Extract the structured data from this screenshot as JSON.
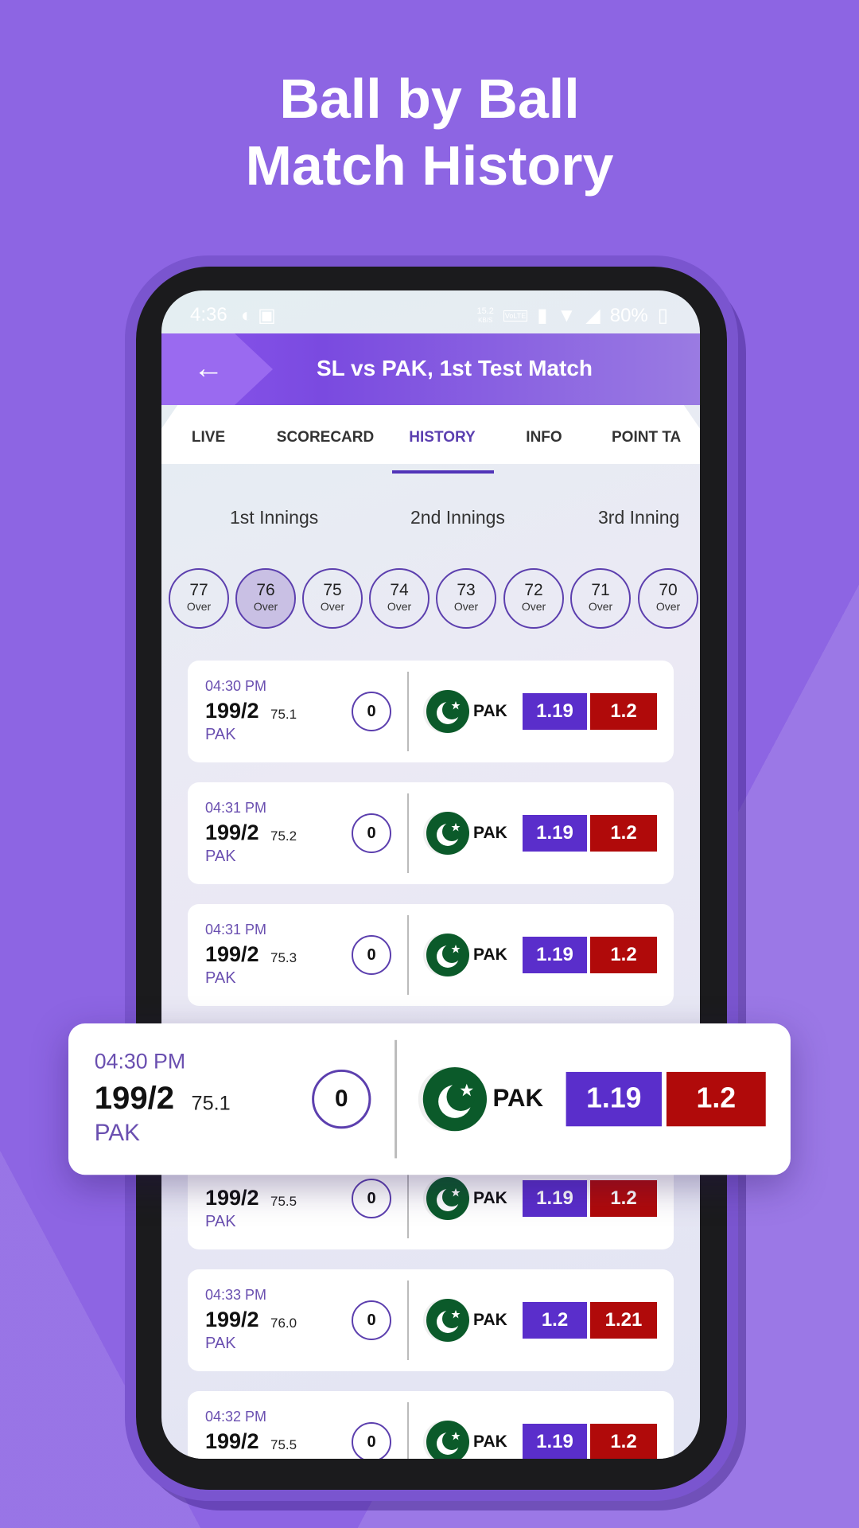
{
  "headline": {
    "line1": "Ball by Ball",
    "line2": "Match History"
  },
  "status_bar": {
    "time": "4:36",
    "speed": "15.2",
    "speed_unit": "KB/S",
    "network": "VoLTE",
    "battery": "80%"
  },
  "app_bar": {
    "title": "SL vs PAK, 1st Test Match",
    "back_icon": "arrow-left-icon"
  },
  "tabs": [
    {
      "label": "LIVE"
    },
    {
      "label": "SCORECARD"
    },
    {
      "label": "HISTORY",
      "active": true
    },
    {
      "label": "INFO"
    },
    {
      "label": "POINT TA"
    }
  ],
  "innings": [
    {
      "label": "1st Innings"
    },
    {
      "label": "2nd Innings"
    },
    {
      "label": "3rd Inning"
    }
  ],
  "overs": [
    {
      "n": "77",
      "l": "Over"
    },
    {
      "n": "76",
      "l": "Over",
      "selected": true
    },
    {
      "n": "75",
      "l": "Over"
    },
    {
      "n": "74",
      "l": "Over"
    },
    {
      "n": "73",
      "l": "Over"
    },
    {
      "n": "72",
      "l": "Over"
    },
    {
      "n": "71",
      "l": "Over"
    },
    {
      "n": "70",
      "l": "Over"
    }
  ],
  "rows": [
    {
      "time": "04:30 PM",
      "score": "199/2",
      "over": "75.1",
      "team": "PAK",
      "ball": "0",
      "flag_team": "PAK",
      "back": "1.19",
      "lay": "1.2"
    },
    {
      "time": "04:31 PM",
      "score": "199/2",
      "over": "75.2",
      "team": "PAK",
      "ball": "0",
      "flag_team": "PAK",
      "back": "1.19",
      "lay": "1.2"
    },
    {
      "time": "04:31 PM",
      "score": "199/2",
      "over": "75.3",
      "team": "PAK",
      "ball": "0",
      "flag_team": "PAK",
      "back": "1.19",
      "lay": "1.2"
    },
    null,
    {
      "time": "",
      "score": "199/2",
      "over": "75.5",
      "team": "PAK",
      "ball": "0",
      "flag_team": "PAK",
      "back": "1.19",
      "lay": "1.2"
    },
    {
      "time": "04:33 PM",
      "score": "199/2",
      "over": "76.0",
      "team": "PAK",
      "ball": "0",
      "flag_team": "PAK",
      "back": "1.2",
      "lay": "1.21"
    },
    {
      "time": "04:32 PM",
      "score": "199/2",
      "over": "75.5",
      "team": "PAK",
      "ball": "0",
      "flag_team": "PAK",
      "back": "1.19",
      "lay": "1.2"
    }
  ],
  "popup": {
    "time": "04:30 PM",
    "score": "199/2",
    "over": "75.1",
    "team": "PAK",
    "ball": "0",
    "flag_team": "PAK",
    "back": "1.19",
    "lay": "1.2"
  },
  "colors": {
    "background": "#8d65e3",
    "accent": "#5134b8",
    "back_odds": "#5a2ecb",
    "lay_odds": "#b00a0a",
    "flag_green": "#0b5a2a"
  }
}
